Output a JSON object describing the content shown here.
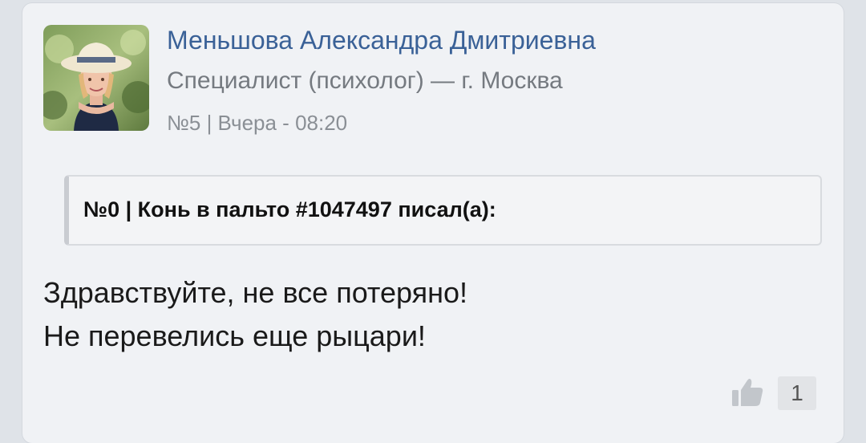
{
  "post": {
    "author": {
      "name": "Меньшова Александра Дмитриевна",
      "role": "Специалист (психолог) — г. Москва"
    },
    "meta": "№5 | Вчера - 08:20",
    "quote": {
      "header": "№0 | Конь в пальто #1047497 писал(а):"
    },
    "message_lines": [
      "Здравствуйте, не все потеряно!",
      "Не перевелись еще рыцари!"
    ],
    "likes": {
      "icon": "thumbs-up-icon",
      "count": "1"
    }
  },
  "colors": {
    "author_name": "#3a6197",
    "card_background": "#f0f2f5"
  }
}
